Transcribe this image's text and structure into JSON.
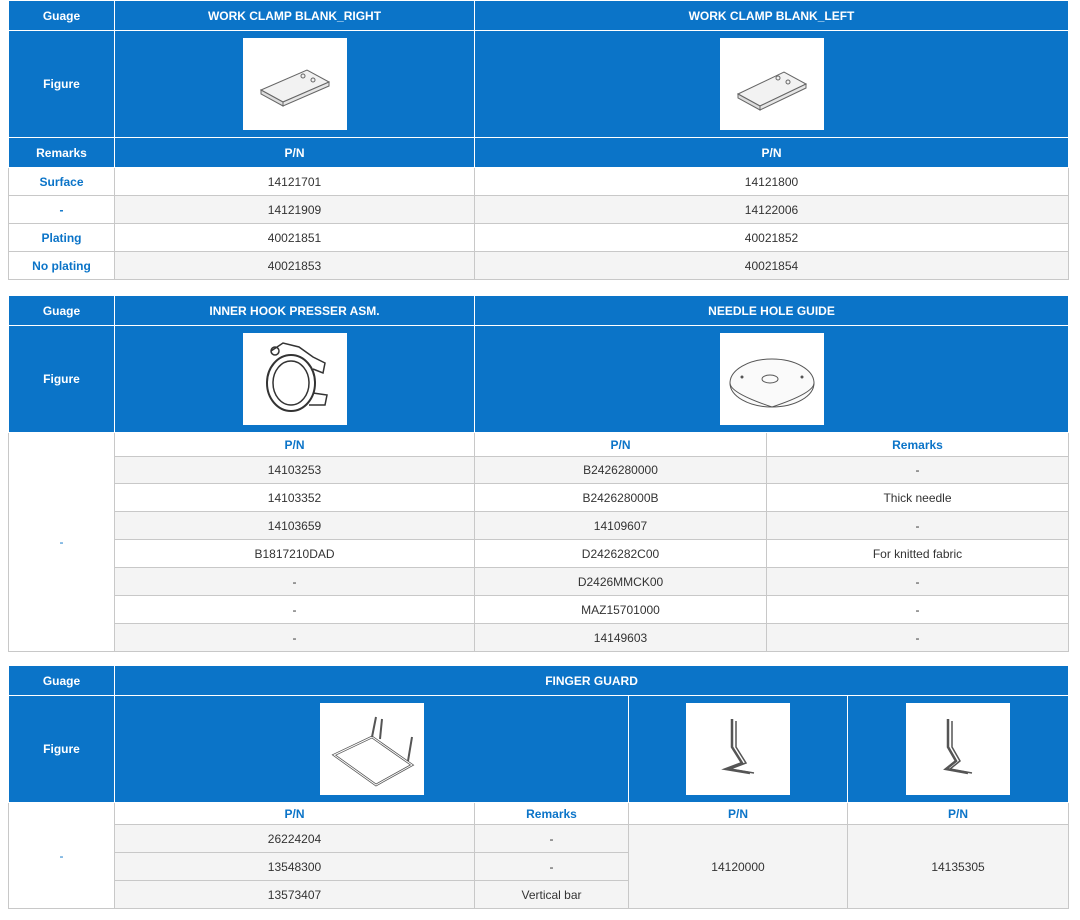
{
  "t1": {
    "guage": "Guage",
    "col_right": "WORK CLAMP BLANK_RIGHT",
    "col_left": "WORK CLAMP BLANK_LEFT",
    "figure": "Figure",
    "remarks": "Remarks",
    "pn": "P/N",
    "rows": [
      {
        "label": "Surface",
        "right": "14121701",
        "left": "14121800"
      },
      {
        "label": "-",
        "right": "14121909",
        "left": "14122006"
      },
      {
        "label": "Plating",
        "right": "40021851",
        "left": "40021852"
      },
      {
        "label": "No plating",
        "right": "40021853",
        "left": "40021854"
      }
    ]
  },
  "t2": {
    "guage": "Guage",
    "col_a": "INNER HOOK PRESSER ASM.",
    "col_b": "NEEDLE HOLE GUIDE",
    "figure": "Figure",
    "side": "-",
    "pn_a": "P/N",
    "pn_b": "P/N",
    "remarks": "Remarks",
    "rows": [
      {
        "a": "14103253",
        "b": "B2426280000",
        "r": "-"
      },
      {
        "a": "14103352",
        "b": "B242628000B",
        "r": "Thick needle"
      },
      {
        "a": "14103659",
        "b": "14109607",
        "r": "-"
      },
      {
        "a": "B1817210DAD",
        "b": "D2426282C00",
        "r": "For knitted fabric"
      },
      {
        "a": "-",
        "b": "D2426MMCK00",
        "r": "-"
      },
      {
        "a": "-",
        "b": "MAZ15701000",
        "r": "-"
      },
      {
        "a": "-",
        "b": "14149603",
        "r": "-"
      }
    ]
  },
  "t3": {
    "guage": "Guage",
    "title": "FINGER GUARD",
    "figure": "Figure",
    "side": "-",
    "pn1": "P/N",
    "remarks": "Remarks",
    "pn2": "P/N",
    "pn3": "P/N",
    "rows": [
      {
        "pn": "26224204",
        "r": "-"
      },
      {
        "pn": "13548300",
        "r": "-"
      },
      {
        "pn": "13573407",
        "r": "Vertical bar"
      }
    ],
    "pn2_value": "14120000",
    "pn3_value": "14135305"
  }
}
